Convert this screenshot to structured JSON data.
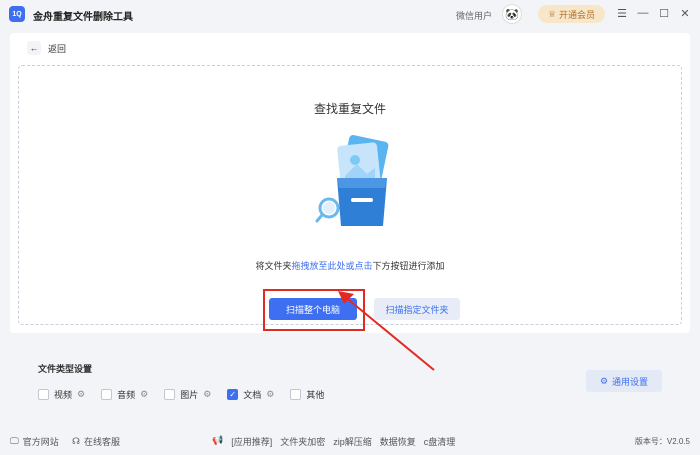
{
  "app": {
    "logo_text": "1Q",
    "title": "金舟重复文件删除工具"
  },
  "header": {
    "user_label": "微信用户",
    "vip_label": "开通会员",
    "avatar_icon": "panda-avatar-icon"
  },
  "window_controls": {
    "menu": "☰",
    "minimize": "—",
    "maximize": "☐",
    "close": "✕"
  },
  "main": {
    "back_label": "返回",
    "drop_title": "查找重复文件",
    "hint_before": "将文件夹",
    "hint_link": "拖拽放至此处或点击",
    "hint_after": "下方按钮进行添加",
    "scan_pc_label": "扫描整个电脑",
    "scan_folder_label": "扫描指定文件夹"
  },
  "settings": {
    "title": "文件类型设置",
    "types": [
      {
        "label": "视频",
        "checked": false
      },
      {
        "label": "音频",
        "checked": false
      },
      {
        "label": "图片",
        "checked": false
      },
      {
        "label": "文档",
        "checked": true
      },
      {
        "label": "其他",
        "checked": false
      }
    ],
    "general_label": "通用设置"
  },
  "footer": {
    "website": "官方网站",
    "support": "在线客服",
    "links": [
      "[应用推荐]",
      "文件夹加密",
      "zip解压缩",
      "数据恢复",
      "c盘清理"
    ],
    "version": "版本号：V2.0.5"
  },
  "colors": {
    "accent": "#3d6ff0",
    "annotation": "#e22a22",
    "vip": "#f8e6c8"
  }
}
